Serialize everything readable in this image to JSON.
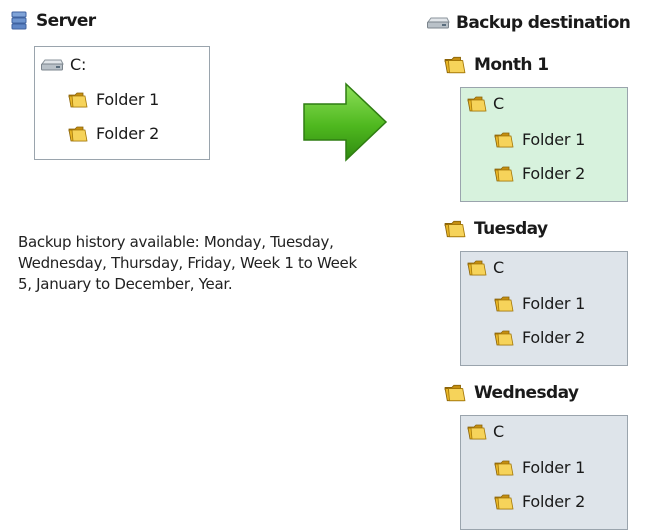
{
  "server": {
    "title": "Server",
    "drive": "C:",
    "folders": [
      "Folder 1",
      "Folder 2"
    ]
  },
  "note": "Backup history available: Monday, Tuesday, Wednesday, Thursday, Friday, Week 1 to Week 5, January to December, Year.",
  "destination": {
    "title": "Backup destination",
    "sets": [
      {
        "name": "Month 1",
        "drive": "C",
        "folders": [
          "Folder 1",
          "Folder 2"
        ]
      },
      {
        "name": "Tuesday",
        "drive": "C",
        "folders": [
          "Folder 1",
          "Folder 2"
        ]
      },
      {
        "name": "Wednesday",
        "drive": "C",
        "folders": [
          "Folder 1",
          "Folder 2"
        ]
      }
    ]
  },
  "colors": {
    "arrow": "#4fb81f",
    "highlight_box": "#d7f2dd",
    "normal_box": "#dee4ea",
    "folder": "#e9b626"
  },
  "icons": {
    "server": "server-icon",
    "drive": "drive-icon",
    "folder": "folder-icon",
    "arrow": "right-arrow-icon"
  }
}
